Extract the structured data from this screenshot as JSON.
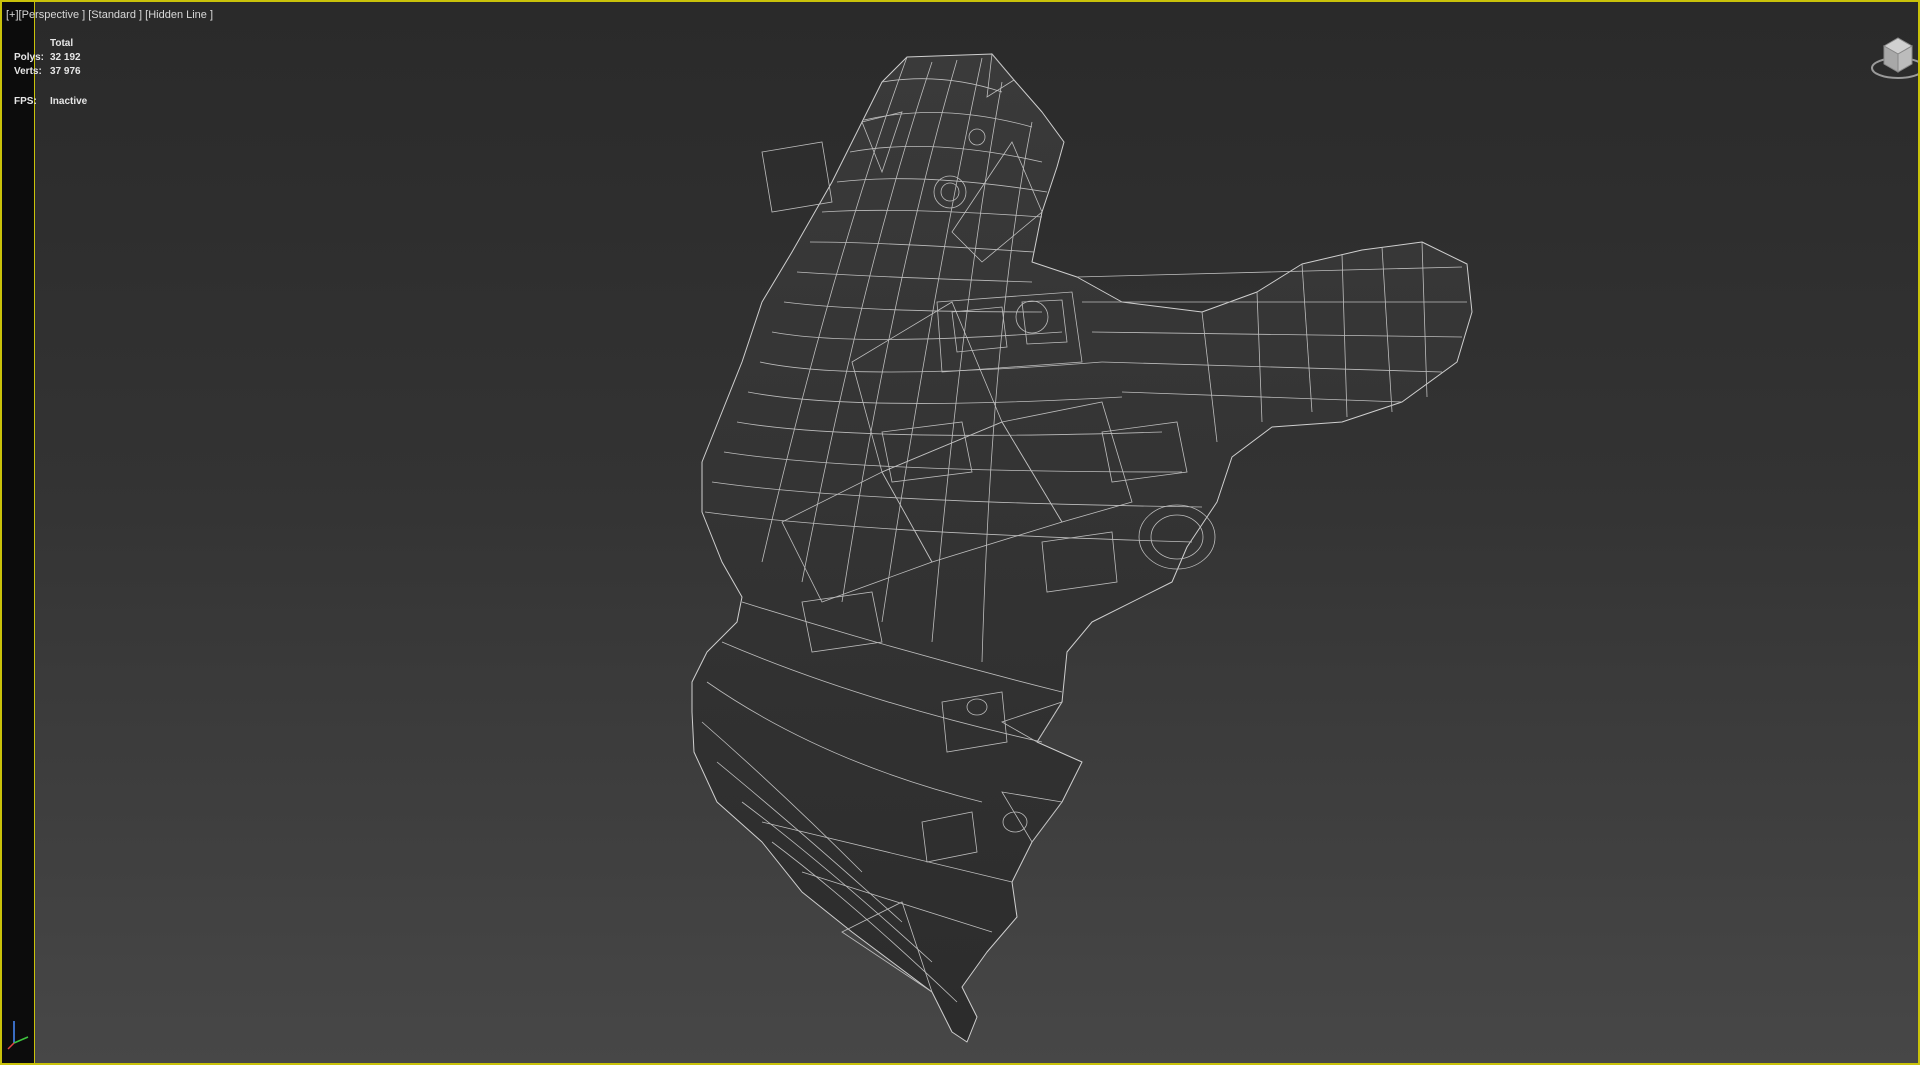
{
  "viewport": {
    "label_plus": "[+]",
    "label_view": "[Perspective ]",
    "label_shading": "[Standard ]",
    "label_mode": "[Hidden Line ]",
    "border_color": "#c9c20a"
  },
  "stats": {
    "header": "Total",
    "polys_label": "Polys:",
    "polys_value": "32 192",
    "verts_label": "Verts:",
    "verts_value": "37 976",
    "fps_label": "FPS:",
    "fps_value": "Inactive"
  },
  "icons": {
    "viewcube": "viewcube-icon",
    "axis": "axis-tripod-icon"
  }
}
